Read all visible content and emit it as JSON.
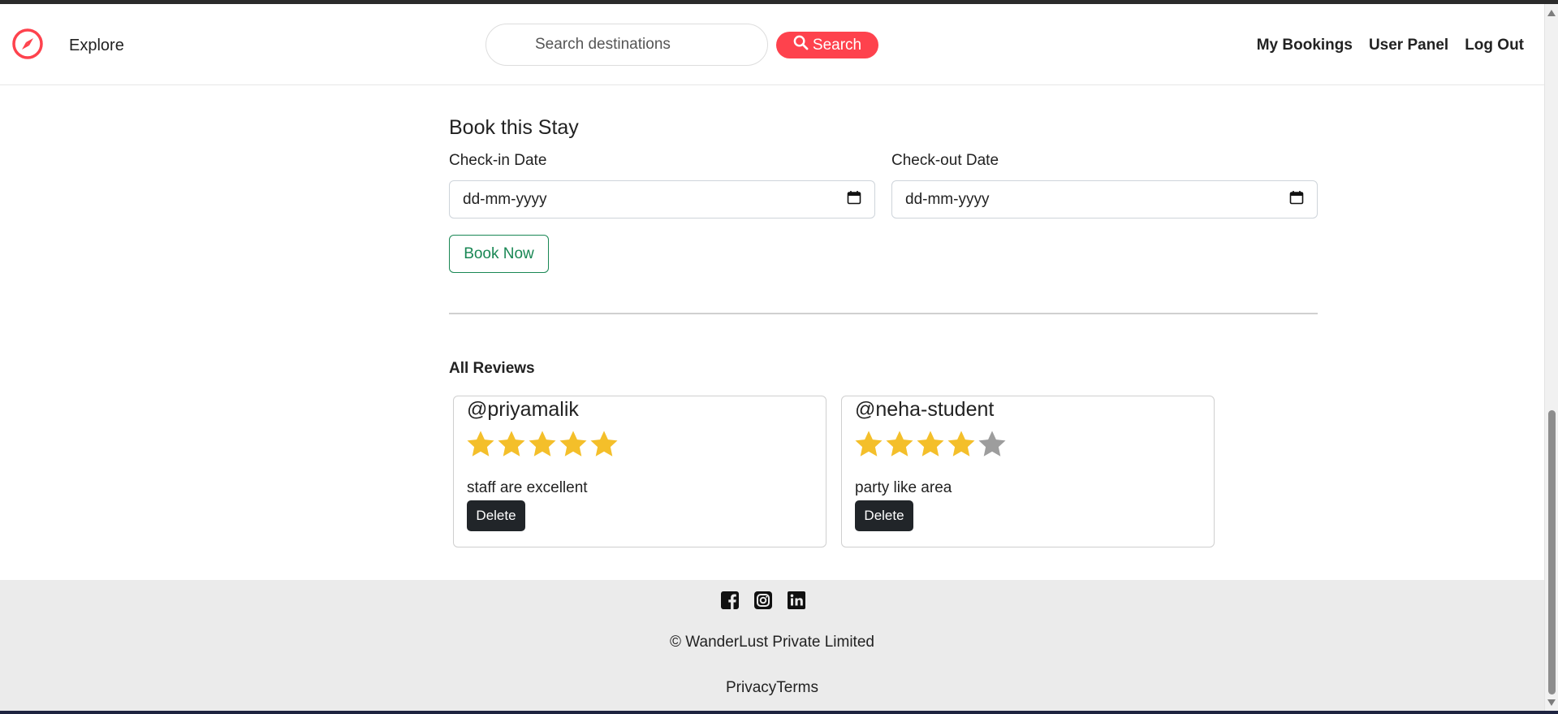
{
  "navbar": {
    "logo_icon": "compass-icon",
    "explore_label": "Explore",
    "search_placeholder": "Search destinations",
    "search_button_label": "Search",
    "links": [
      "My Bookings",
      "User Panel",
      "Log Out"
    ],
    "accent_color": "#fe424d"
  },
  "booking": {
    "title": "Book this Stay",
    "checkin_label": "Check-in Date",
    "checkout_label": "Check-out Date",
    "checkin_value": "dd-mm-yyyy",
    "checkout_value": "dd-mm-yyyy",
    "book_button_label": "Book Now",
    "button_color": "#198754"
  },
  "reviews": {
    "heading": "All Reviews",
    "items": [
      {
        "author": "@priyamalik",
        "rating": 5,
        "max_rating": 5,
        "comment": "staff are excellent",
        "delete_label": "Delete"
      },
      {
        "author": "@neha-student",
        "rating": 4,
        "max_rating": 5,
        "comment": "party like area",
        "delete_label": "Delete"
      }
    ],
    "star_color": "#f4bf2a",
    "empty_star_color": "#9d9d9d"
  },
  "footer": {
    "social_icons": [
      "facebook-icon",
      "instagram-icon",
      "linkedin-icon"
    ],
    "copyright": "© WanderLust Private Limited",
    "privacy_label": "Privacy",
    "terms_label": "Terms"
  }
}
